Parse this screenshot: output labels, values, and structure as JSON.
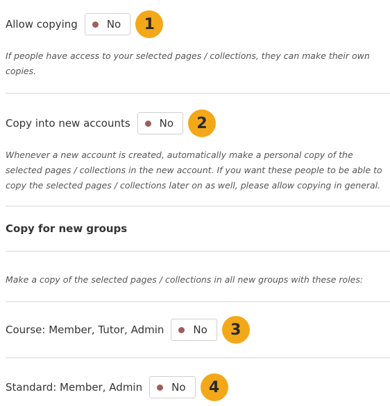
{
  "allow_copying": {
    "label": "Allow copying",
    "value": "No",
    "badge": "1",
    "description": "If people have access to your selected pages / collections, they can make their own copies."
  },
  "copy_new_accounts": {
    "label": "Copy into new accounts",
    "value": "No",
    "badge": "2",
    "description": "Whenever a new account is created, automatically make a personal copy of the selected pages / collections in the new account. If you want these people to be able to copy the selected pages / collections later on as well, please allow copying in general."
  },
  "copy_new_groups": {
    "heading": "Copy for new groups",
    "description": "Make a copy of the selected pages / collections in all new groups with these roles:",
    "course": {
      "label": "Course: Member, Tutor, Admin",
      "value": "No",
      "badge": "3"
    },
    "standard": {
      "label": "Standard: Member, Admin",
      "value": "No",
      "badge": "4"
    }
  },
  "colors": {
    "badge": "#f3a81a",
    "toggle_dot": "#9e5f5a",
    "divider": "#d9d9d9"
  }
}
